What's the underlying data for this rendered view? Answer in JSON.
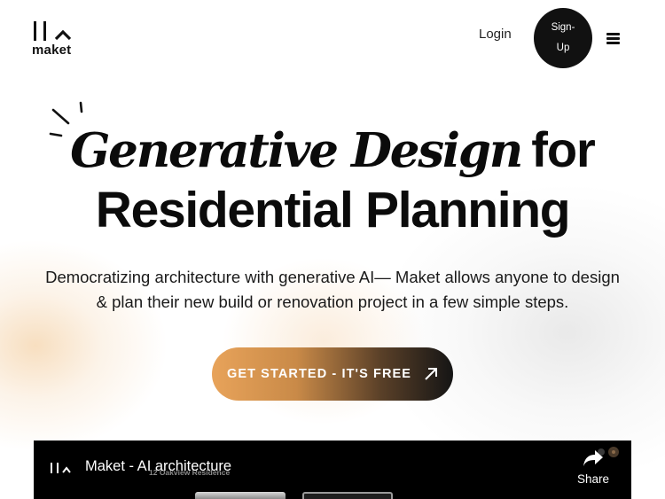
{
  "colors": {
    "background": "#ffffff",
    "text": "#111111",
    "signup_bg": "#111111",
    "cta_gradient_start": "#e8a35a",
    "cta_gradient_end": "#151515",
    "video_bg": "#000000"
  },
  "header": {
    "logo_text": "maket",
    "logo_icon": "maket-logo-icon",
    "login_label": "Login",
    "signup_label": "Sign-Up",
    "menu_icon": "hamburger-menu-icon"
  },
  "hero": {
    "decoration_icon": "sparkle-lines-icon",
    "title_serif": "Generative Design",
    "title_sans": "for",
    "title_line2": "Residential Planning",
    "subtitle_line1": "Democratizing architecture with generative AI— Maket allows anyone to design",
    "subtitle_line2": "& plan their new build or renovation project in a few simple steps.",
    "cta_label": "GET STARTED - IT'S FREE",
    "cta_icon": "arrow-up-right-icon"
  },
  "video": {
    "title": "Maket - AI architecture",
    "overlay_text": "12 Oakview Residence",
    "share_label": "Share",
    "share_icon": "share-arrow-icon"
  }
}
